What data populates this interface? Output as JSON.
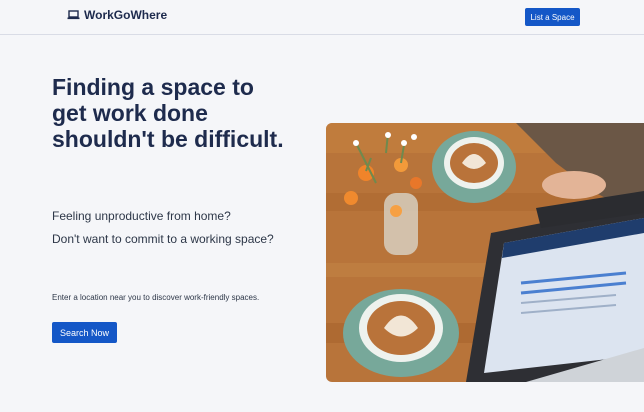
{
  "header": {
    "brand": "WorkGoWhere",
    "cta_label": "List a Space"
  },
  "hero": {
    "title": "Finding a space to get work done shouldn't be difficult.",
    "line1": "Feeling unproductive from home?",
    "line2": "Don't want to commit to a working space?",
    "hint": "Enter a location near you to discover work-friendly spaces.",
    "search_label": "Search Now"
  },
  "colors": {
    "accent": "#1457c7",
    "title": "#1e2b4d",
    "background": "#f5f6f9"
  },
  "icons": {
    "brand_icon": "laptop-icon"
  }
}
